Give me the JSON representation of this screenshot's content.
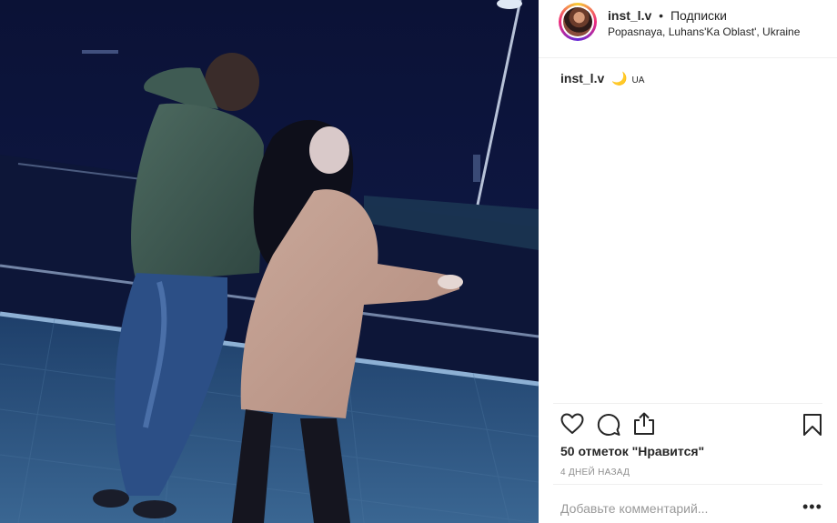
{
  "post": {
    "photo_alt": "",
    "header": {
      "username": "inst_l.v",
      "separator": "•",
      "follow_label": "Подписки",
      "location": "Popasnaya, Luhans'Ka Oblast', Ukraine"
    },
    "caption": {
      "username": "inst_l.v",
      "emoji": "🌙",
      "flag_text": "UA"
    },
    "actions": {
      "like_icon": "heart-icon",
      "comment_icon": "comment-icon",
      "share_icon": "share-icon",
      "save_icon": "bookmark-icon"
    },
    "likes_text": "50 отметок \"Нравится\"",
    "timestamp": "4 ДНЕЙ НАЗАД",
    "comment_placeholder": "Добавьте комментарий...",
    "more_label": "•••"
  },
  "colors": {
    "text": "#262626",
    "muted": "#8e8e8e",
    "border": "#efefef",
    "photo_bg": "#0c1540"
  }
}
